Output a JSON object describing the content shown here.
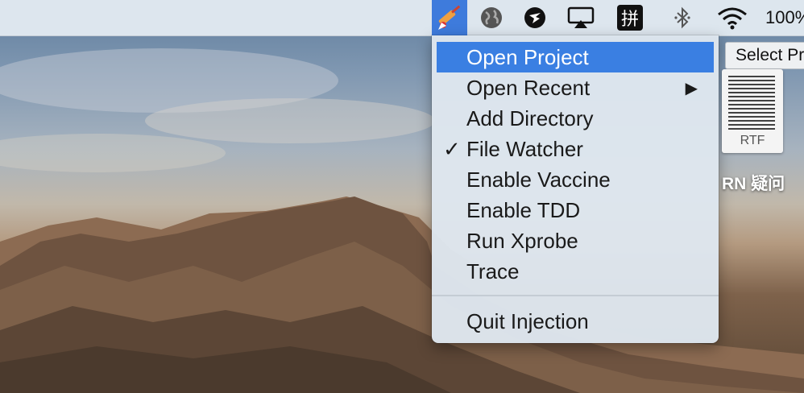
{
  "menubar": {
    "status_icons": [
      "injection-app-icon",
      "globe-icon",
      "shield-bird-icon",
      "airplay-icon",
      "pinyin-input-icon",
      "bluetooth-icon",
      "wifi-icon"
    ],
    "pinyin_label": "拼",
    "battery_label": "100%"
  },
  "menu": {
    "items": [
      {
        "label": "Open Project",
        "selected": true
      },
      {
        "label": "Open Recent",
        "submenu": true
      },
      {
        "label": "Add Directory"
      },
      {
        "label": "File Watcher",
        "checked": true
      },
      {
        "label": "Enable Vaccine"
      },
      {
        "label": "Enable TDD"
      },
      {
        "label": "Run Xprobe"
      },
      {
        "label": "Trace"
      },
      {
        "label": "Quit Injection"
      }
    ],
    "check_glyph": "✓",
    "submenu_arrow": "▶"
  },
  "tooltip": {
    "text": "Select Project"
  },
  "desktop": {
    "file": {
      "ext": "RTF",
      "name": "RN 疑问"
    }
  },
  "colors": {
    "highlight": "#3a7fe2",
    "menubar": "#dde6ee"
  }
}
